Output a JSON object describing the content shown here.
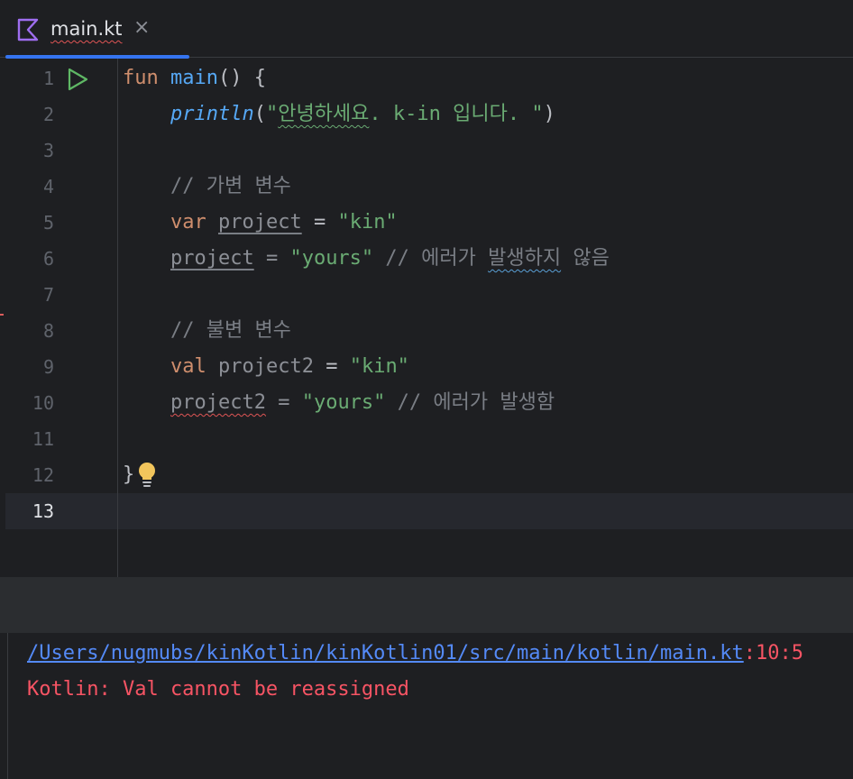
{
  "tab": {
    "title": "main.kt",
    "close_glyph": "×",
    "accent": "#3574f0"
  },
  "icons": {
    "file_icon": "kotlin-file-icon",
    "run_icon": "run-gutter-icon",
    "intention_icon": "lightbulb-icon"
  },
  "editor": {
    "line_numbers": [
      "1",
      "2",
      "3",
      "4",
      "5",
      "6",
      "7",
      "8",
      "9",
      "10",
      "11",
      "12",
      "13"
    ],
    "active_line": 13,
    "lines": {
      "l1": {
        "kw": "fun",
        "fn": "main",
        "rest": "() {"
      },
      "l2": {
        "fn": "println",
        "open": "(",
        "str_a": "\"",
        "str_b": "안녕하세요",
        "str_c": ". k-in 입니다. \"",
        "close": ")"
      },
      "l4": {
        "comment": "// 가변 변수"
      },
      "l5": {
        "kw": "var",
        "name": "project",
        "op": "=",
        "str": "\"kin\""
      },
      "l6": {
        "name": "project",
        "op": "=",
        "str": "\"yours\"",
        "comment_a": "// 에러가 ",
        "comment_b": "발생하지",
        "comment_c": " 않음"
      },
      "l8": {
        "comment": "// 불변 변수"
      },
      "l9": {
        "kw": "val",
        "name": "project2",
        "op": "=",
        "str": "\"kin\""
      },
      "l10": {
        "name": "project2",
        "op": "=",
        "str": "\"yours\"",
        "comment": "// 에러가 발생함"
      },
      "l12": {
        "brace": "}"
      }
    }
  },
  "output": {
    "path": "/Users/nugmubs/kinKotlin/kinKotlin01/src/main/kotlin/main.kt",
    "position": ":10:5",
    "error": "Kotlin: Val cannot be reassigned"
  },
  "colors": {
    "background": "#1e1f22",
    "keyword": "#cf8e6d",
    "function": "#56a8f5",
    "string": "#6aab73",
    "comment": "#7a7e85",
    "error": "#f75464",
    "link": "#548af7"
  }
}
